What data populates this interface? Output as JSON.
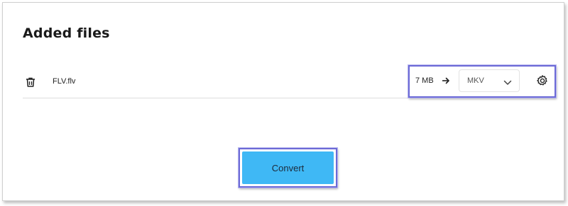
{
  "header": {
    "title": "Added files"
  },
  "file": {
    "name": "FLV.flv",
    "size": "7 MB",
    "target_format": "MKV"
  },
  "actions": {
    "convert_label": "Convert"
  },
  "icons": {
    "delete": "trash-icon",
    "arrow": "arrow-right-icon",
    "dropdown": "chevron-down-icon",
    "settings": "gear-icon"
  },
  "colors": {
    "convert_button": "#3fb8f5",
    "highlight_border": "#6c6ad6"
  }
}
